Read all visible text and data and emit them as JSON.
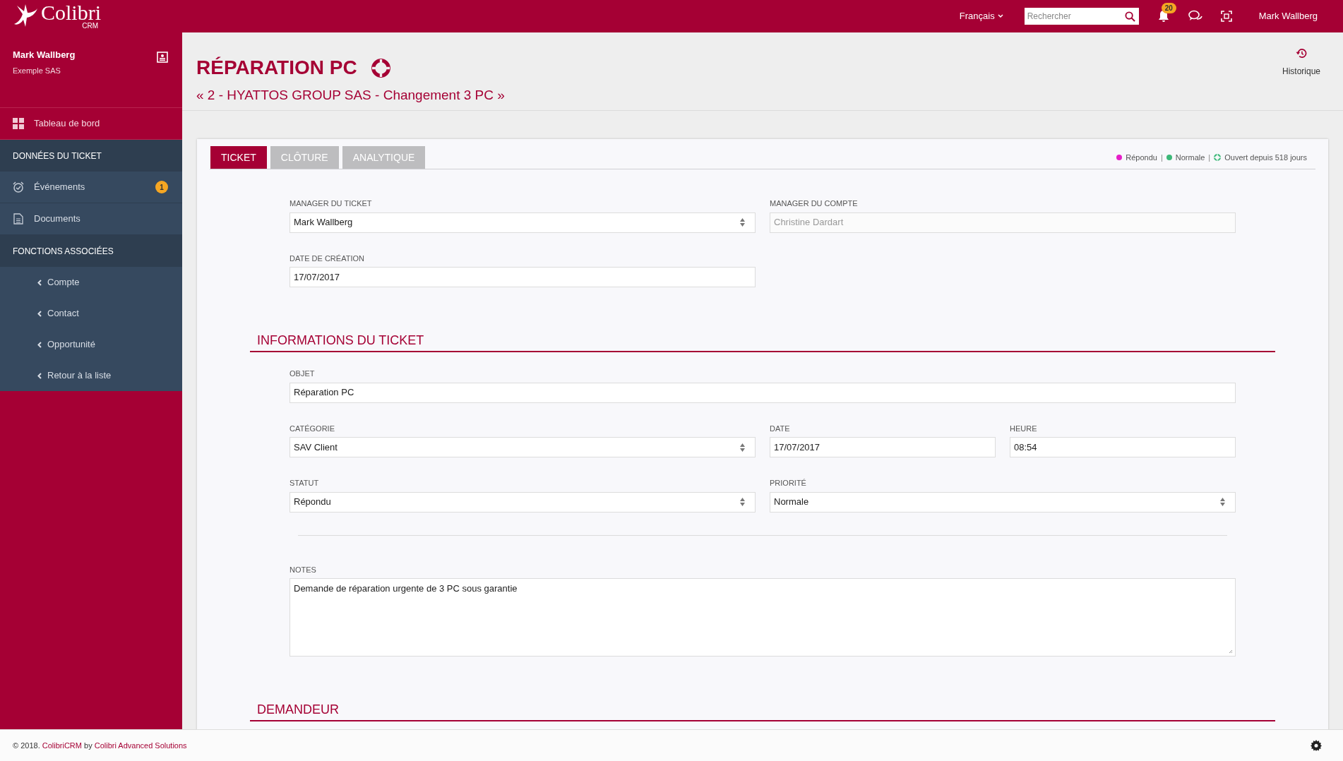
{
  "topbar": {
    "logo": {
      "name": "Colibri",
      "sub": "CRM"
    },
    "language": "Français",
    "search": {
      "placeholder": "Rechercher"
    },
    "notifications": "20",
    "user": "Mark Wallberg"
  },
  "sidebar": {
    "user": {
      "name": "Mark Wallberg",
      "company": "Exemple SAS"
    },
    "items": [
      {
        "kind": "nav",
        "label": "Tableau de bord"
      },
      {
        "kind": "section",
        "label": "DONNÉES DU TICKET"
      },
      {
        "kind": "sub",
        "label": "Événements",
        "badge": "1"
      },
      {
        "kind": "sub",
        "label": "Documents"
      },
      {
        "kind": "section",
        "label": "FONCTIONS ASSOCIÉES"
      },
      {
        "kind": "link",
        "label": "Compte"
      },
      {
        "kind": "link",
        "label": "Contact"
      },
      {
        "kind": "link",
        "label": "Opportunité"
      },
      {
        "kind": "link",
        "label": "Retour à la liste"
      }
    ]
  },
  "header": {
    "title": "RÉPARATION PC",
    "subtitle": "« 2 - HYATTOS GROUP SAS - Changement 3 PC »",
    "history": "Historique"
  },
  "tabs": [
    {
      "label": "TICKET",
      "selected": true
    },
    {
      "label": "CLÔTURE",
      "selected": false
    },
    {
      "label": "ANALYTIQUE",
      "selected": false
    }
  ],
  "status": [
    {
      "kind": "dot",
      "label": "Répondu",
      "color": "#e61ec8"
    },
    {
      "kind": "dot",
      "label": "Normale",
      "color": "#3cb878",
      "separator": "|"
    },
    {
      "kind": "age",
      "label": "Ouvert depuis 518 jours",
      "separator": "|"
    }
  ],
  "form": [
    {
      "kind": "row",
      "fields": [
        {
          "kind": "select",
          "label": "MANAGER DU TICKET",
          "value": "Mark Wallberg",
          "disabled": false
        },
        {
          "kind": "input",
          "label": "MANAGER DU COMPTE",
          "value": "Christine Dardart",
          "disabled": true
        }
      ]
    },
    {
      "kind": "row",
      "fields": [
        {
          "kind": "input",
          "label": "DATE DE CRÉATION",
          "value": "17/07/2017",
          "disabled": false
        }
      ]
    },
    {
      "kind": "section",
      "title": "INFORMATIONS DU TICKET"
    },
    {
      "kind": "row",
      "fields": [
        {
          "kind": "input",
          "label": "OBJET",
          "value": "Réparation PC",
          "disabled": false
        }
      ]
    },
    {
      "kind": "row",
      "fields": [
        {
          "kind": "select",
          "label": "CATÉGORIE",
          "value": "SAV Client",
          "disabled": false
        },
        {
          "kind": "input",
          "label": "DATE",
          "value": "17/07/2017",
          "disabled": false
        },
        {
          "kind": "input",
          "label": "HEURE",
          "value": "08:54",
          "disabled": false
        }
      ]
    },
    {
      "kind": "row",
      "fields": [
        {
          "kind": "select",
          "label": "STATUT",
          "value": "Répondu",
          "disabled": false
        },
        {
          "kind": "select",
          "label": "PRIORITÉ",
          "value": "Normale",
          "disabled": false
        }
      ]
    },
    {
      "kind": "divider"
    },
    {
      "kind": "row",
      "fields": [
        {
          "kind": "textarea",
          "label": "NOTES",
          "value": "Demande de réparation urgente de 3 PC sous garantie",
          "disabled": false
        }
      ]
    },
    {
      "kind": "section",
      "title": "DEMANDEUR"
    }
  ],
  "footer": {
    "copyright": "© 2018.",
    "app_link": "ColibriCRM",
    "by": "by",
    "company_link": "Colibri Advanced Solutions"
  }
}
